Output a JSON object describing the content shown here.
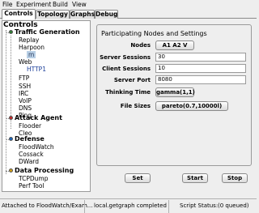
{
  "menu": {
    "file": "File",
    "experiment": "Experiment",
    "build": "Build",
    "view": "View"
  },
  "tabs": {
    "controls": "Controls",
    "topology": "Topology",
    "graphs": "Graphs",
    "debug": "Debug"
  },
  "tree": {
    "root": "Controls",
    "traffic": {
      "label": "Traffic Generation",
      "color": "#2e7d32",
      "replay": "Replay",
      "harpoon": "Harpoon",
      "harpoon_child": "m",
      "web": "Web",
      "web_child": "HTTP1",
      "ftp": "FTP",
      "ssh": "SSH",
      "irc": "IRC",
      "voip": "VoIP",
      "dns": "DNS",
      "ping": "Ping"
    },
    "attack": {
      "label": "Attack Agent",
      "color": "#c62828",
      "flooder": "Flooder",
      "cleo": "Cleo"
    },
    "defense": {
      "label": "Defense",
      "color": "#1565c0",
      "floodwatch": "FloodWatch",
      "cossack": "Cossack",
      "dward": "DWard"
    },
    "processing": {
      "label": "Data Processing",
      "color": "#d4a017",
      "tcpdump": "TCPDump",
      "perftool": "Perf Tool"
    }
  },
  "panel": {
    "title": "Participating Nodes and Settings",
    "nodes_label": "Nodes",
    "nodes_value": "A1 A2 V",
    "server_sessions_label": "Server Sessions",
    "server_sessions_value": "30",
    "client_sessions_label": "Client Sessions",
    "client_sessions_value": "10",
    "server_port_label": "Server Port",
    "server_port_value": "8080",
    "thinking_time_label": "Thinking Time",
    "thinking_time_value": "gamma(1,1)",
    "file_sizes_label": "File Sizes",
    "file_sizes_value": "pareto(0.7,10000l)"
  },
  "actions": {
    "set": "Set",
    "start": "Start",
    "stop": "Stop"
  },
  "status": {
    "attached": "Attached to FloodWatch/Exam...",
    "message": "local.getgraph completed",
    "script_label": "Script Status:",
    "script_value": "(0 queued)"
  }
}
